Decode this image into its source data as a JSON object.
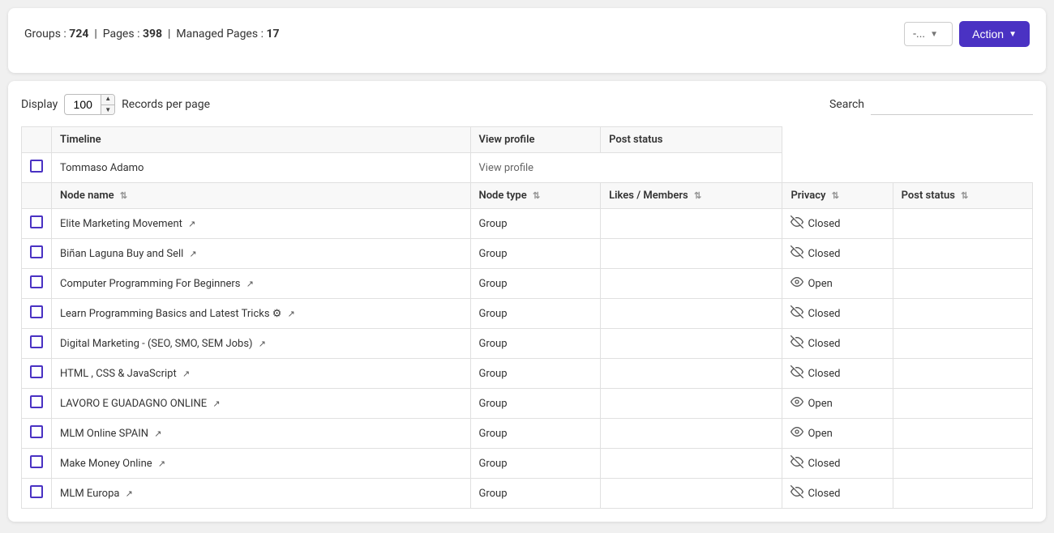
{
  "header": {
    "groups_label": "Groups",
    "groups_count": "724",
    "pages_label": "Pages",
    "pages_count": "398",
    "managed_pages_label": "Managed Pages",
    "managed_pages_count": "17",
    "selector_value": "-...",
    "action_button": "Action"
  },
  "controls": {
    "display_label": "Display",
    "records_value": "100",
    "records_per_page_label": "Records per page",
    "search_label": "Search"
  },
  "table": {
    "header_row1": {
      "timeline": "Timeline",
      "view_profile": "View profile",
      "post_status": "Post status"
    },
    "user_row": {
      "name": "Tommaso Adamo",
      "view_profile": "View profile"
    },
    "columns": [
      {
        "key": "node_name",
        "label": "Node name",
        "sortable": true
      },
      {
        "key": "node_type",
        "label": "Node type",
        "sortable": true
      },
      {
        "key": "likes_members",
        "label": "Likes / Members",
        "sortable": true
      },
      {
        "key": "privacy",
        "label": "Privacy",
        "sortable": true
      },
      {
        "key": "post_status",
        "label": "Post status",
        "sortable": true
      }
    ],
    "rows": [
      {
        "id": 1,
        "name": "Elite Marketing Movement",
        "external": true,
        "type": "Group",
        "likes": "",
        "privacy": "Closed",
        "privacy_type": "closed",
        "post_status": ""
      },
      {
        "id": 2,
        "name": "Biñan Laguna Buy and Sell",
        "external": true,
        "type": "Group",
        "likes": "",
        "privacy": "Closed",
        "privacy_type": "closed",
        "post_status": ""
      },
      {
        "id": 3,
        "name": "Computer Programming For Beginners",
        "external": true,
        "type": "Group",
        "likes": "",
        "privacy": "Open",
        "privacy_type": "open",
        "post_status": ""
      },
      {
        "id": 4,
        "name": "Learn Programming Basics and Latest Tricks ⚙",
        "external": true,
        "type": "Group",
        "likes": "",
        "privacy": "Closed",
        "privacy_type": "closed",
        "post_status": ""
      },
      {
        "id": 5,
        "name": "Digital Marketing - (SEO, SMO, SEM Jobs)",
        "external": true,
        "type": "Group",
        "likes": "",
        "privacy": "Closed",
        "privacy_type": "closed",
        "post_status": ""
      },
      {
        "id": 6,
        "name": "HTML , CSS & JavaScript",
        "external": true,
        "type": "Group",
        "likes": "",
        "privacy": "Closed",
        "privacy_type": "closed",
        "post_status": ""
      },
      {
        "id": 7,
        "name": "LAVORO E GUADAGNO ONLINE",
        "external": true,
        "type": "Group",
        "likes": "",
        "privacy": "Open",
        "privacy_type": "open",
        "post_status": ""
      },
      {
        "id": 8,
        "name": "MLM Online SPAIN",
        "external": true,
        "type": "Group",
        "likes": "",
        "privacy": "Open",
        "privacy_type": "open",
        "post_status": ""
      },
      {
        "id": 9,
        "name": "Make Money Online",
        "external": true,
        "type": "Group",
        "likes": "",
        "privacy": "Closed",
        "privacy_type": "closed",
        "post_status": ""
      },
      {
        "id": 10,
        "name": "MLM Europa",
        "external": true,
        "type": "Group",
        "likes": "",
        "privacy": "Closed",
        "privacy_type": "closed",
        "post_status": ""
      }
    ]
  },
  "icons": {
    "external_link": "↗",
    "sort": "⇅",
    "closed_eye": "🚫👁",
    "open_eye": "👁",
    "dropdown_arrow": "▼",
    "spinner_up": "▲",
    "spinner_down": "▼"
  },
  "colors": {
    "accent": "#4a32c3",
    "border": "#e0e0e0",
    "header_bg": "#f8f8f8"
  }
}
